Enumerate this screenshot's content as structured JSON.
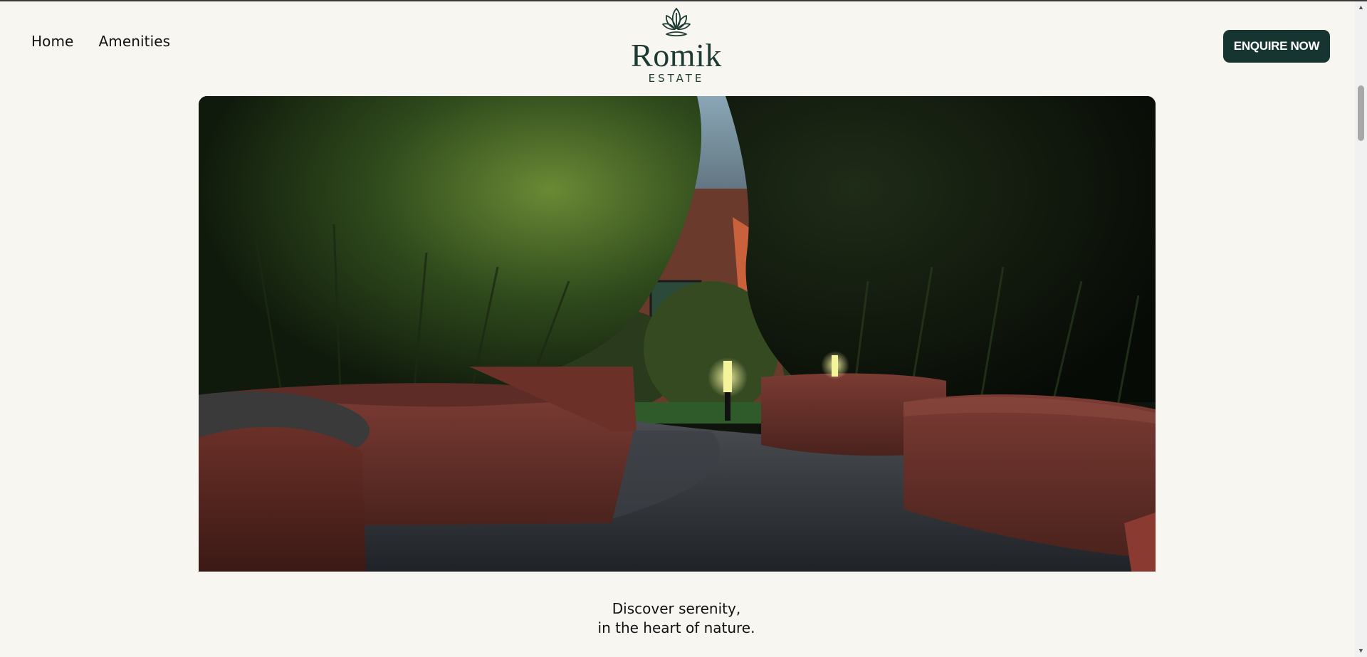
{
  "nav": {
    "items": [
      {
        "label": "Home"
      },
      {
        "label": "Amenities"
      }
    ]
  },
  "logo": {
    "name": "Romik",
    "subtitle": "ESTATE",
    "icon": "lotus-leaf-icon"
  },
  "header": {
    "cta_label": "ENQUIRE NOW"
  },
  "hero": {
    "image": "garden-courtyard-with-bamboo-planters"
  },
  "tagline": {
    "line1": "Discover serenity,",
    "line2": "in the heart of nature."
  },
  "scrollbar": {
    "up_icon": "scroll-up-arrow-icon",
    "down_icon": "scroll-down-arrow-icon"
  },
  "colors": {
    "background": "#f8f6f0",
    "brand": "#163530",
    "logo": "#1d3a33"
  }
}
